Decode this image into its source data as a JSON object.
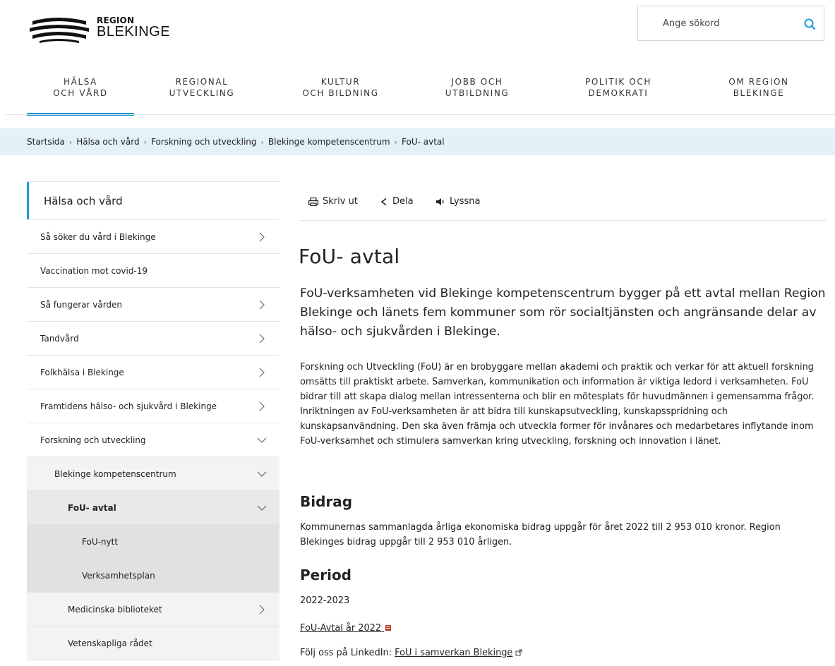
{
  "header": {
    "logo_line1": "REGION",
    "logo_line2": "BLEKINGE",
    "search_placeholder": "Ange sökord"
  },
  "mainnav": [
    {
      "line1": "Hälsa",
      "line2": "och vård",
      "active": true
    },
    {
      "line1": "Regional",
      "line2": "utveckling",
      "active": false
    },
    {
      "line1": "Kultur",
      "line2": "och bildning",
      "active": false
    },
    {
      "line1": "Jobb och",
      "line2": "utbildning",
      "active": false
    },
    {
      "line1": "Politik och",
      "line2": "demokrati",
      "active": false
    },
    {
      "line1": "Om Region",
      "line2": "Blekinge",
      "active": false
    }
  ],
  "breadcrumb": [
    "Startsida",
    "Hälsa och vård",
    "Forskning och utveckling",
    "Blekinge kompetenscentrum",
    "FoU- avtal"
  ],
  "sidebar": {
    "heading": "Hälsa och vård",
    "items": [
      {
        "label": "Så söker du vård i Blekinge",
        "chevron": "right"
      },
      {
        "label": "Vaccination mot covid-19",
        "chevron": "none"
      },
      {
        "label": "Så fungerar vården",
        "chevron": "right"
      },
      {
        "label": "Tandvård",
        "chevron": "right"
      },
      {
        "label": "Folkhälsa i Blekinge",
        "chevron": "right"
      },
      {
        "label": "Framtidens hälso- och sjukvård i Blekinge",
        "chevron": "right"
      },
      {
        "label": "Forskning och utveckling",
        "chevron": "down"
      },
      {
        "label": "Blekinge kompetenscentrum",
        "chevron": "down"
      },
      {
        "label": "FoU- avtal",
        "chevron": "down"
      },
      {
        "label": "FoU-nytt",
        "chevron": "none"
      },
      {
        "label": "Verksamhetsplan",
        "chevron": "none"
      },
      {
        "label": "Medicinska biblioteket",
        "chevron": "right"
      },
      {
        "label": "Vetenskapliga rådet",
        "chevron": "none"
      }
    ]
  },
  "tools": {
    "print": "Skriv ut",
    "share": "Dela",
    "listen": "Lyssna"
  },
  "article": {
    "title": "FoU- avtal",
    "lead": "FoU-verksamheten vid Blekinge kompetenscentrum bygger på ett avtal mellan Region Blekinge och länets fem kommuner som rör socialtjänsten och angränsande delar av hälso- och sjukvården i Blekinge.",
    "body": "Forskning och Utveckling (FoU) är en brobyggare mellan akademi och praktik och verkar för att aktuell forskning omsätts till praktiskt arbete. Samverkan, kommunikation och information är viktiga ledord i verksamheten. FoU bidrar till att skapa dialog mellan intressenterna och blir en mötesplats för huvudmännen i gemensamma frågor. Inriktningen av FoU-verksamheten är att bidra till kunskapsutveckling, kunskapsspridning och kunskapsanvändning. Den ska även främja och utveckla former för invånares och medarbetares inflytande inom FoU-verksamhet och stimulera samverkan kring utveckling, forskning och innovation i länet.",
    "h_bidrag": "Bidrag",
    "bidrag_text": "Kommunernas sammanlagda årliga ekonomiska bidrag uppgår för året 2022 till 2 953 010 kronor. Region Blekinges bidrag uppgår till 2 953 010 årligen.",
    "h_period": "Period",
    "period_text": "2022-2023",
    "pdf_link": "FoU-Avtal år 2022",
    "follow_prefix": "Följ oss på LinkedIn: ",
    "follow_link": "FoU i samverkan Blekinge"
  },
  "colors": {
    "accent": "#1a9bd7",
    "breadcrumb_bg": "#e3f2f8",
    "pdf_icon": "#c0392b"
  }
}
